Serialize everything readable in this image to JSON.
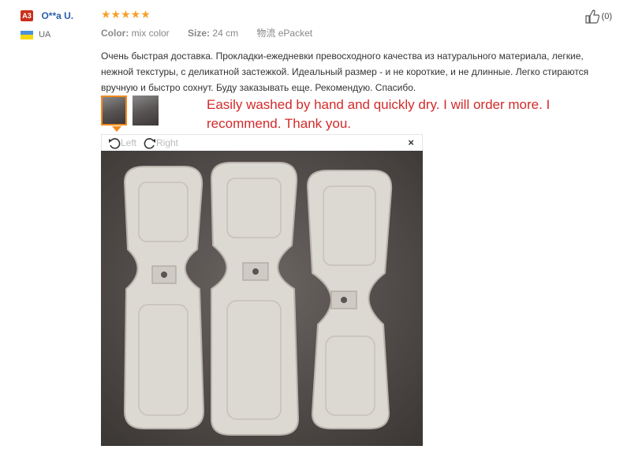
{
  "user": {
    "badge": "A3",
    "name": "O**a U.",
    "country": "UA"
  },
  "rating": {
    "stars": "★★★★★"
  },
  "meta": {
    "color_label": "Color:",
    "color_value": "mix color",
    "size_label": "Size:",
    "size_value": "24 cm",
    "shipping": "物流 ePacket"
  },
  "review_text": "Очень быстрая доставка. Прокладки-ежедневки превосходного качества из натурального материала, легкие, нежной текстуры, с деликатной застежкой. Идеальный размер - и не короткие, и не длинные. Легко стираются вручную и быстро сохнут. Буду заказывать еще. Рекомендую. Спасибо.",
  "translation": "Easily washed by hand and quickly dry. I will order more. I recommend. Thank you.",
  "likes": "(0)",
  "viewer": {
    "rotate_left": "Left",
    "rotate_right": "Right",
    "close": "×"
  },
  "icons": {
    "like": "thumbs-up-icon",
    "rotate_left": "rotate-left-icon",
    "rotate_right": "rotate-right-icon",
    "close": "close-icon"
  }
}
